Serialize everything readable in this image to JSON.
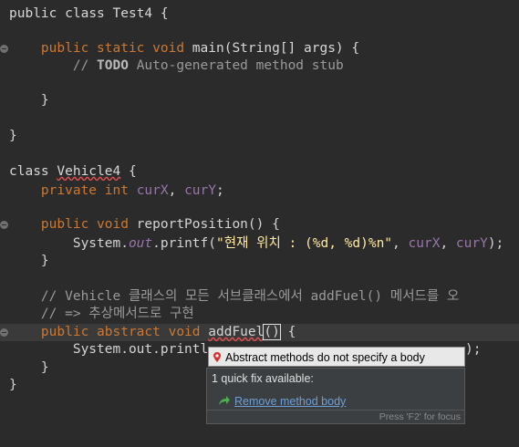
{
  "code": {
    "l1": {
      "kw1": "public",
      "kw2": "class",
      "name": "Test4 {"
    },
    "l2": {
      "kw": "public static void",
      "rest": " main(String[] args) {"
    },
    "l3": {
      "prefix": "// ",
      "todo": "TODO",
      "rest": " Auto-generated method stub"
    },
    "l4": {
      "text": "}"
    },
    "l5": {
      "text": "}"
    },
    "l6": {
      "kw": "class",
      "name": "Vehicle4",
      "rest": " {"
    },
    "l7": {
      "kw": "private int",
      "sp": " ",
      "f1": "curX",
      "sep": ", ",
      "f2": "curY",
      "end": ";"
    },
    "l8": {
      "kw": "public void",
      "rest": " reportPosition() {"
    },
    "l9": {
      "a": "System.",
      "out": "out",
      "b": ".printf(",
      "str": "\"현재 위치 : (%d, %d)%n\"",
      "c": ", ",
      "f1": "curX",
      "d": ", ",
      "f2": "curY",
      "e": ");"
    },
    "l10": {
      "text": "}"
    },
    "l11": {
      "text": "// Vehicle 클래스의 모든 서브클래스에서 addFuel() 메서드를 오"
    },
    "l12": {
      "text": "// => 추상메서드로 구현"
    },
    "l13": {
      "kw": "public abstract void",
      "sp": " ",
      "name": "addFuel",
      "paren": "()",
      "rest": " {"
    },
    "l14": {
      "text": "System.out.printl",
      "tail": ");"
    },
    "l15": {
      "text": "}"
    },
    "l16": {
      "text": "}"
    }
  },
  "tooltip": {
    "message": "Abstract methods do not specify a body",
    "icon": "error-icon"
  },
  "quickfix": {
    "title": "1 quick fix available:",
    "item": "Remove method body",
    "item_icon": "green-arrow-icon",
    "footer": "Press 'F2' for focus"
  },
  "colors": {
    "background": "#2b2b2b",
    "keyword": "#cc7832",
    "comment": "#9a9a9a",
    "string": "#e8bf6a",
    "field": "#9876aa",
    "error": "#e05050",
    "link": "#6d9fd6"
  }
}
